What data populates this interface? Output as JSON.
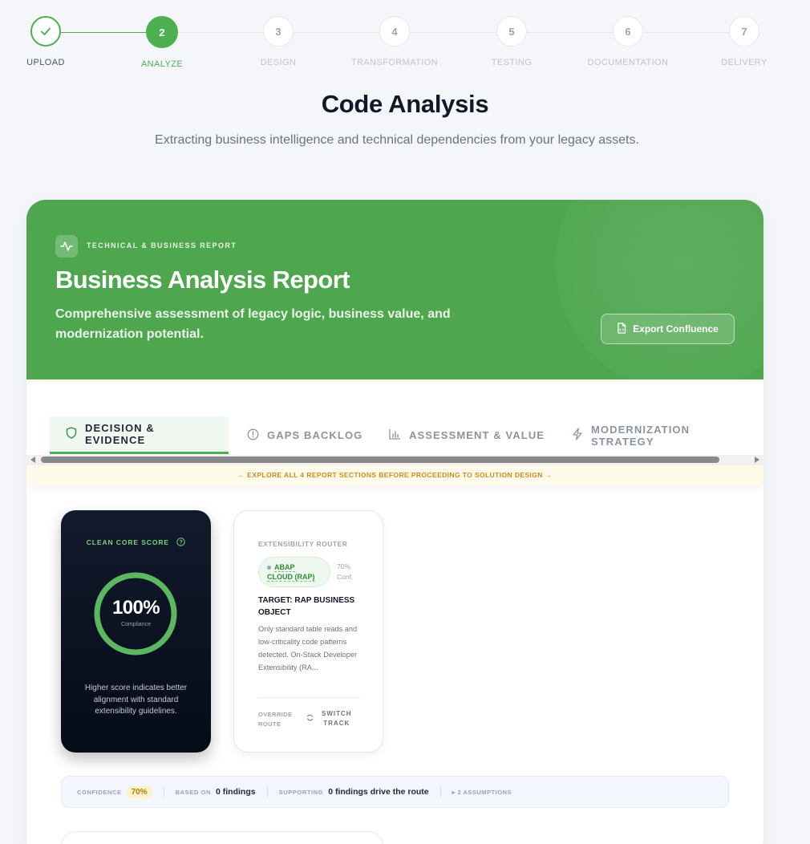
{
  "stepper": {
    "steps": [
      {
        "number": "1",
        "label": "UPLOAD",
        "state": "done"
      },
      {
        "number": "2",
        "label": "ANALYZE",
        "state": "active"
      },
      {
        "number": "3",
        "label": "DESIGN",
        "state": "pending"
      },
      {
        "number": "4",
        "label": "TRANSFORMATION",
        "state": "pending"
      },
      {
        "number": "5",
        "label": "TESTING",
        "state": "pending"
      },
      {
        "number": "6",
        "label": "DOCUMENTATION",
        "state": "pending"
      },
      {
        "number": "7",
        "label": "DELIVERY",
        "state": "pending"
      }
    ]
  },
  "page": {
    "title": "Code Analysis",
    "subtitle": "Extracting business intelligence and technical dependencies from your legacy assets."
  },
  "report": {
    "eyebrow": "TECHNICAL & BUSINESS REPORT",
    "title": "Business Analysis Report",
    "description": "Comprehensive assessment of legacy logic, business value, and modernization potential.",
    "export_label": "Export Confluence",
    "tabs": [
      {
        "label": "DECISION & EVIDENCE",
        "icon": "shield-icon"
      },
      {
        "label": "GAPS BACKLOG",
        "icon": "alert-circle-icon"
      },
      {
        "label": "ASSESSMENT & VALUE",
        "icon": "bar-chart-icon"
      },
      {
        "label": "MODERNIZATION STRATEGY",
        "icon": "lightning-icon"
      }
    ],
    "notice": "← EXPLORE ALL 4 REPORT SECTIONS BEFORE PROCEEDING TO SOLUTION DESIGN →"
  },
  "score": {
    "label": "CLEAN CORE SCORE",
    "value": "100%",
    "value_fraction": 1.0,
    "sub": "Compliance",
    "description": "Higher score indicates better alignment with standard extensibility guidelines."
  },
  "router": {
    "label": "EXTENSIBILITY ROUTER",
    "pill_line1": "ABAP",
    "pill_line2": "CLOUD (RAP)",
    "confidence_pct": "70%",
    "confidence_word": "Conf.",
    "target": "TARGET: RAP BUSINESS OBJECT",
    "description": "Only standard table reads and low-criticality code patterns detected. On-Stack Developer Extensibility (RA...",
    "override_line1": "OVERRIDE",
    "override_line2": "ROUTE",
    "switch_line1": "SWITCH",
    "switch_line2": "TRACK"
  },
  "evidence": {
    "confidence_key": "CONFIDENCE",
    "confidence_value": "70%",
    "based_key": "BASED ON",
    "based_value": "0 findings",
    "supporting_key": "SUPPORTING",
    "supporting_value": "0 findings drive the route",
    "assumptions": "▸ 2 ASSUMPTIONS"
  },
  "colors": {
    "brand_green": "#4caf50",
    "hero_green": "#4ea64e",
    "score_card_bg": "#0b1222",
    "warning_text": "#d4891a"
  }
}
